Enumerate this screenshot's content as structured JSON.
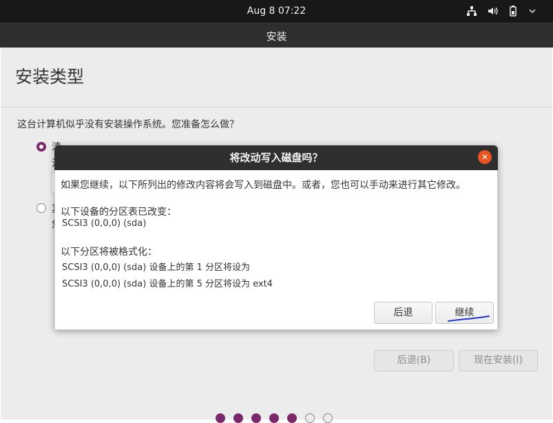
{
  "topbar": {
    "clock": "Aug 8  07:22",
    "tray_icons": [
      "network-icon",
      "volume-icon",
      "battery-icon",
      "power-menu-icon"
    ]
  },
  "window": {
    "title": "安装"
  },
  "installer": {
    "page_title": "安装类型",
    "question": "这台计算机似乎没有安装操作系统。您准备怎么做？",
    "option1_label": "清",
    "option1_sub": "注",
    "option2_label": "其",
    "option2_sub": "您",
    "back_button": "后退(B)",
    "install_button": "现在安装(I)",
    "progress": {
      "completed_steps": 5,
      "total_steps": 7
    }
  },
  "dialog": {
    "title": "将改动写入磁盘吗？",
    "intro": "如果您继续，以下所列出的修改内容将会写入到磁盘中。或者，您也可以手动来进行其它修改。",
    "partition_table_heading": "以下设备的分区表已改变：",
    "partition_table_device": "SCSI3 (0,0,0) (sda)",
    "format_heading": "以下分区将被格式化：",
    "format_line_1": "SCSI3 (0,0,0) (sda) 设备上的第 1 分区将设为",
    "format_line_2": "SCSI3 (0,0,0) (sda) 设备上的第 5 分区将设为 ext4",
    "back_button": "后退",
    "continue_button": "继续"
  },
  "colors": {
    "accent": "#7a2a6a",
    "close": "#e95420",
    "annotation": "#1a2fd0"
  }
}
